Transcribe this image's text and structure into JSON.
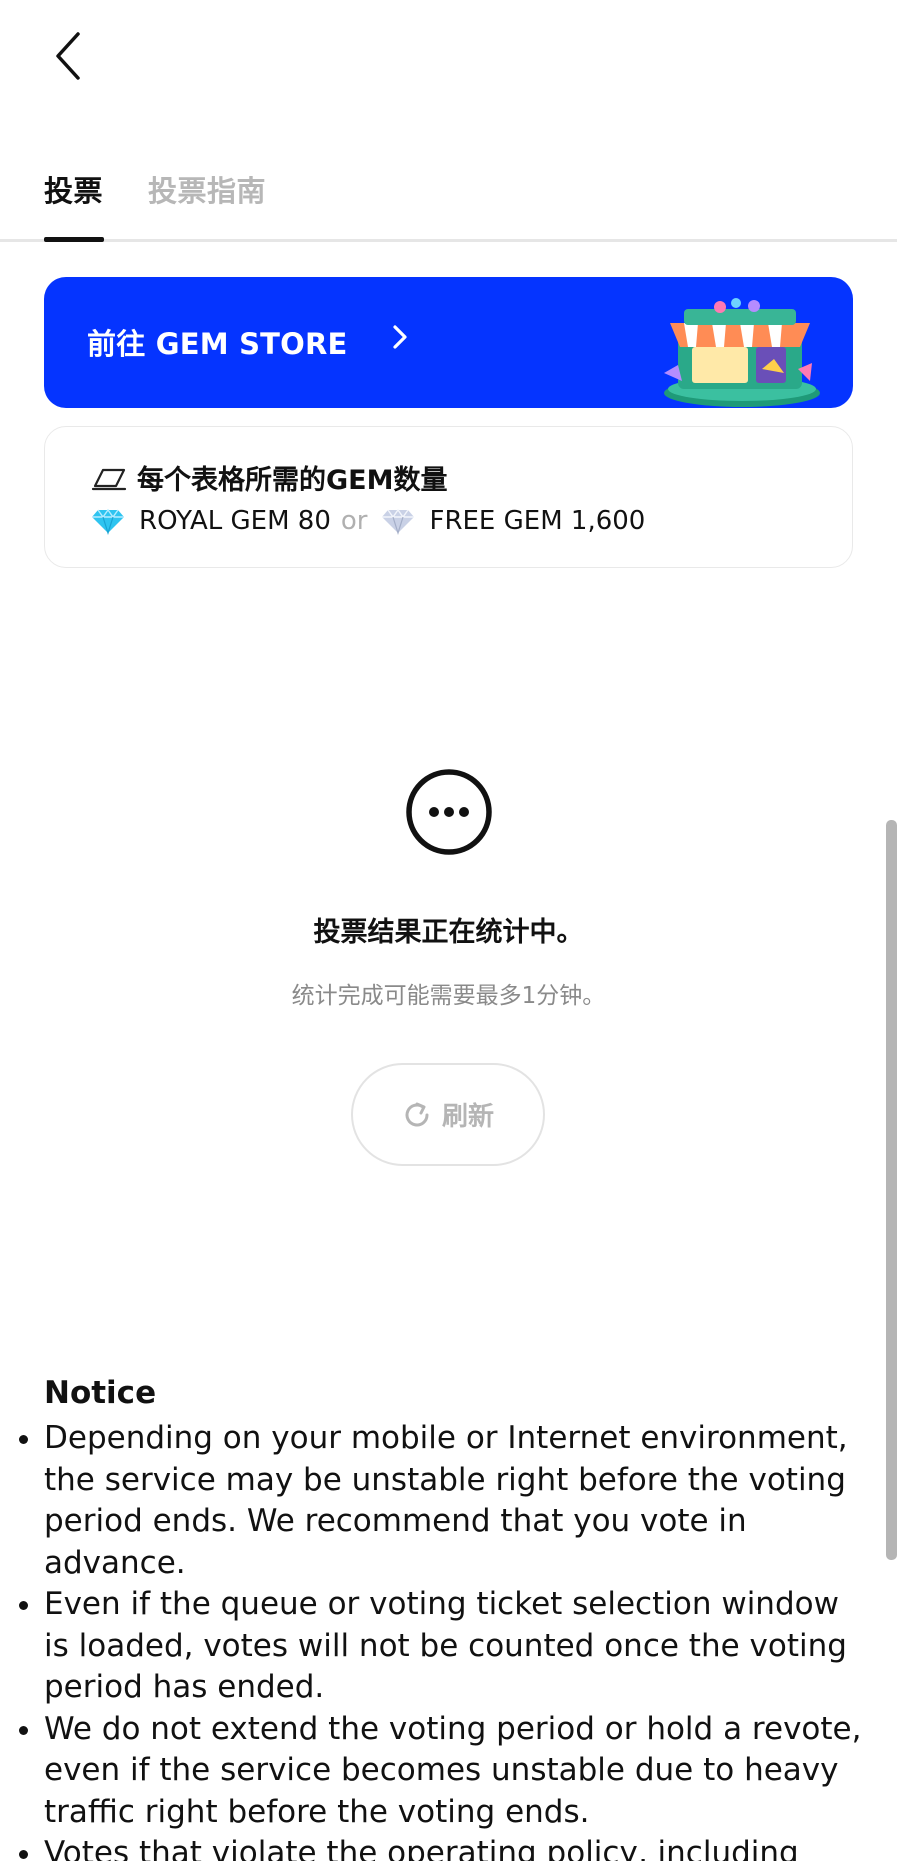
{
  "tabs": [
    {
      "label": "投票"
    },
    {
      "label": "投票指南"
    }
  ],
  "banner": {
    "label": "前往 GEM STORE"
  },
  "gem_card": {
    "title": "每个表格所需的GEM数量",
    "royal_gem": "ROYAL GEM 80",
    "or": "or",
    "free_gem": "FREE GEM 1,600"
  },
  "status": {
    "title": "投票结果正在统计中。",
    "subtitle": "统计完成可能需要最多1分钟。",
    "refresh_label": "刷新"
  },
  "notice": {
    "title": "Notice",
    "items": [
      "Depending on your mobile or Internet environment, the service may be unstable right before the voting period ends. We recommend that you vote in advance.",
      "Even if the queue or voting ticket selection window is loaded, votes will not be counted once the voting period has ended.",
      "We do not extend the voting period or hold a revote, even if the service becomes unstable due to heavy traffic right before the voting ends.",
      "Votes that violate the operating policy, including"
    ]
  },
  "colors": {
    "banner_bg": "#0534ff",
    "royal_gem": "#2ec4f0",
    "free_gem": "#b9c3da",
    "inactive_tab": "#b7b7b7"
  },
  "icons": {
    "back": "back-arrow-icon",
    "chevron": "chevron-right-icon",
    "ticket": "ticket-icon",
    "royal_gem": "royal-gem-icon",
    "free_gem": "free-gem-icon",
    "status": "more-dots-icon",
    "refresh": "refresh-icon"
  }
}
